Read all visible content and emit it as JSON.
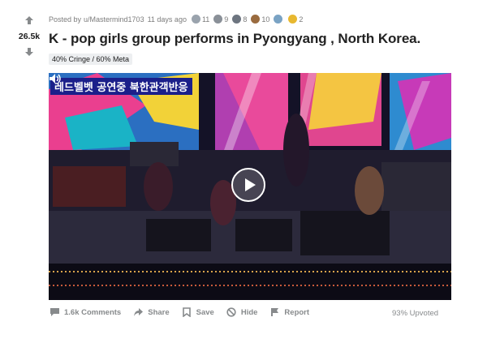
{
  "post": {
    "meta_prefix": "Posted by ",
    "author": "u/Mastermind1703",
    "time_ago": "11 days ago",
    "awards": [
      {
        "icon": "silver-award-icon",
        "count": "11",
        "color": "#9aa3ad"
      },
      {
        "icon": "helpful-award-icon",
        "count": "9",
        "color": "#8a9098"
      },
      {
        "icon": "wholesome-award-icon",
        "count": "8",
        "color": "#6d7580"
      },
      {
        "icon": "bear-award-icon",
        "count": "10",
        "color": "#9a6b3f"
      },
      {
        "icon": "rocket-award-icon",
        "count": "",
        "color": "#7aa3c4"
      },
      {
        "icon": "gold-award-icon",
        "count": "2",
        "color": "#e8b830"
      }
    ],
    "title": "K - pop girls group performs in Pyongyang , North Korea.",
    "flair": "40% Cringe / 60% Meta",
    "video_caption": "레드벨벳  공연중  북한관객반응"
  },
  "votes": {
    "score": "26.5k"
  },
  "actions": {
    "comments": "1.6k Comments",
    "share": "Share",
    "save": "Save",
    "hide": "Hide",
    "report": "Report",
    "upvoted": "93% Upvoted"
  }
}
